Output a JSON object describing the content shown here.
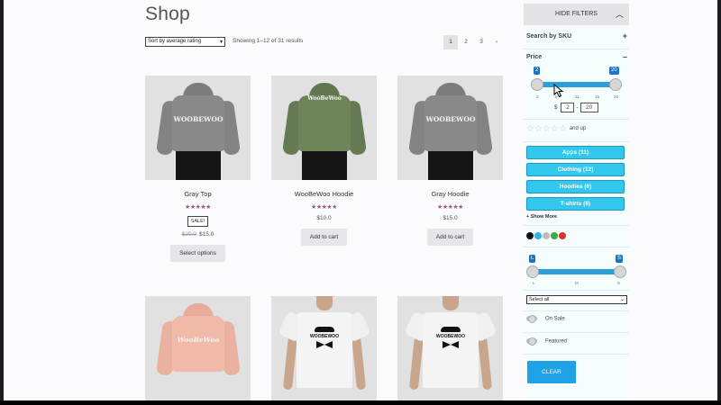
{
  "shop": {
    "title": "Shop",
    "sort_value": "Sort by average rating",
    "result_count": "Showing 1–12 of 31 results",
    "pagination": [
      "1",
      "2",
      "3",
      "›"
    ],
    "current_page": 1
  },
  "products": [
    {
      "name": "Gray Top",
      "rating": "★★★★★",
      "sale_badge": "SALE!",
      "old_price": "$20.0",
      "price": "$15.0",
      "button": "Select options",
      "garment": "gray-hoodie",
      "print": "WOOBEWOO"
    },
    {
      "name": "WooBeWoo Hoodie",
      "rating": "★★★★★",
      "price": "$10.0",
      "button": "Add to cart",
      "garment": "green-hoodie",
      "print": "WooBeWoo"
    },
    {
      "name": "Gray Hoodie",
      "rating": "★★★★★",
      "price": "$15.0",
      "button": "Add to cart",
      "garment": "gray-hoodie",
      "print": "WOOBEWOO"
    },
    {
      "garment": "pink-hoodie",
      "print": "WooBeWoo"
    },
    {
      "garment": "white-tee",
      "print": "WOOBEWOO"
    },
    {
      "garment": "white-tee",
      "print": "WOOBEWOO"
    }
  ],
  "colors": {
    "gray_hoodie": "#8a8a8a",
    "green_hoodie": "#6e8459",
    "pink_hoodie": "#f1b9a7",
    "accent": "#33c7ee",
    "clear": "#1fa2e6"
  },
  "sidebar": {
    "hide_filters": "HIDE FILTERS",
    "search_sku": {
      "title": "Search by SKU",
      "toggle": "+"
    },
    "price": {
      "title": "Price",
      "toggle": "–",
      "min_badge": "2",
      "max_badge": "20",
      "currency": "$",
      "min_value": "2",
      "max_value": "20",
      "separator": "-",
      "tick_labels": [
        "2",
        "6",
        "11",
        "15",
        "20"
      ]
    },
    "rating": {
      "stars": "☆☆☆☆☆",
      "label": "and up"
    },
    "categories": [
      {
        "label": "Apps (11)"
      },
      {
        "label": "Clothing (12)"
      },
      {
        "label": "Hoodies (6)"
      },
      {
        "label": "T-shirts (6)"
      }
    ],
    "show_more": "+ Show More",
    "swatches": [
      "#111111",
      "#2bb5e8",
      "#bdbdbd",
      "#3caa3c",
      "#d9342b"
    ],
    "size_slider": {
      "min_badge": "L",
      "max_badge": "S",
      "tick_labels": [
        "L",
        "M",
        "S"
      ]
    },
    "attribute_select": "Select all",
    "on_sale": "On Sale",
    "featured": "Featured",
    "clear": "CLEAR"
  }
}
